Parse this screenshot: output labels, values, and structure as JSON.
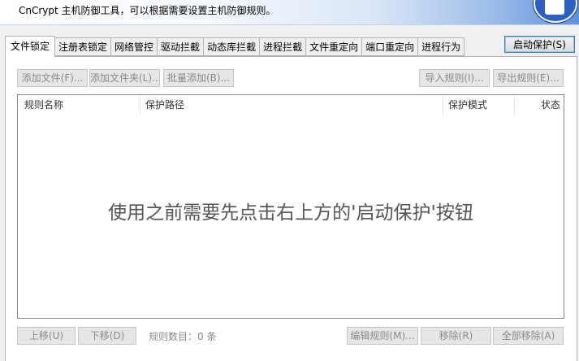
{
  "header": {
    "description": "CnCrypt 主机防御工具，可以根据需要设置主机防御规则。"
  },
  "tabs": [
    {
      "label": "文件锁定",
      "active": true
    },
    {
      "label": "注册表锁定",
      "active": false
    },
    {
      "label": "网络管控",
      "active": false
    },
    {
      "label": "驱动拦截",
      "active": false
    },
    {
      "label": "动态库拦截",
      "active": false
    },
    {
      "label": "进程拦截",
      "active": false
    },
    {
      "label": "文件重定向",
      "active": false
    },
    {
      "label": "端口重定向",
      "active": false
    },
    {
      "label": "进程行为",
      "active": false
    }
  ],
  "start_button": "启动保护(S)",
  "toolbar": {
    "add_file": "添加文件(F)...",
    "add_folder": "添加文件夹(L)...",
    "batch_add": "批量添加(B)...",
    "import_rules": "导入规则(I)...",
    "export_rules": "导出规则(E)..."
  },
  "table": {
    "columns": [
      "规则名称",
      "保护路径",
      "保护模式",
      "状态"
    ],
    "rows": [],
    "empty_hint": "使用之前需要先点击右上方的'启动保护'按钮"
  },
  "footer": {
    "move_up": "上移(U)",
    "move_down": "下移(D)",
    "rule_count": "规则数目：0 条",
    "edit_rule": "编辑规则(M)...",
    "remove": "移除(R)",
    "remove_all": "全部移除(A)"
  }
}
